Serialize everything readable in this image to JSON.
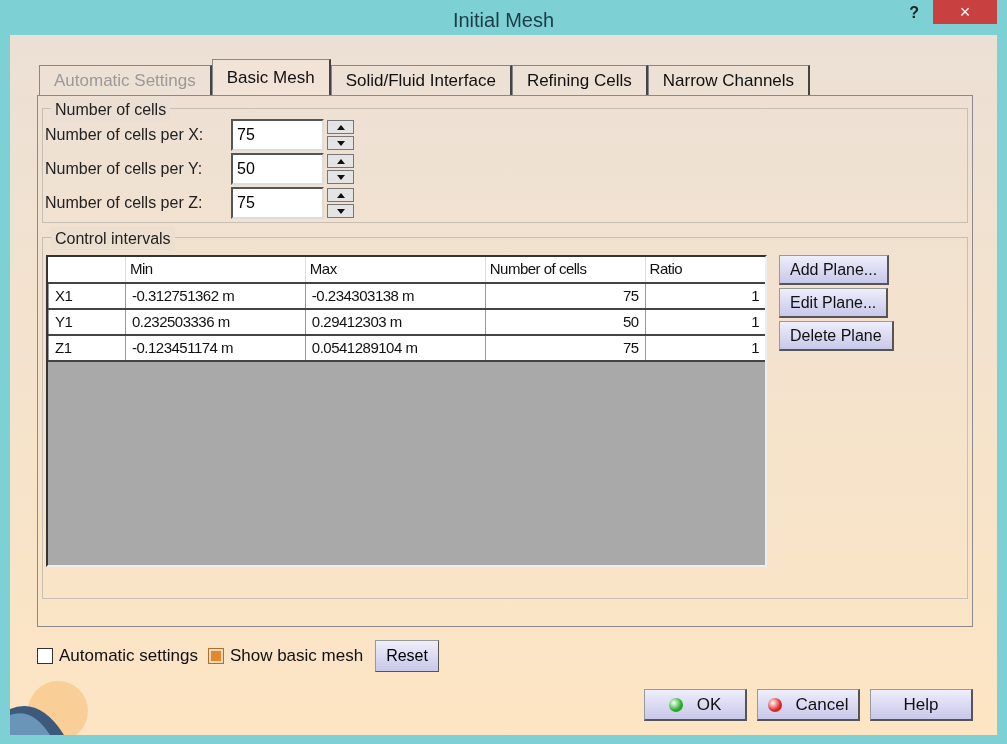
{
  "window": {
    "title": "Initial Mesh",
    "help": "?",
    "close": "×"
  },
  "tabs": [
    {
      "label": "Automatic Settings",
      "selected": false,
      "disabled": true
    },
    {
      "label": "Basic Mesh",
      "selected": true,
      "disabled": false
    },
    {
      "label": "Solid/Fluid Interface",
      "selected": false,
      "disabled": false
    },
    {
      "label": "Refining Cells",
      "selected": false,
      "disabled": false
    },
    {
      "label": "Narrow Channels",
      "selected": false,
      "disabled": false
    }
  ],
  "number_of_cells": {
    "title": "Number of cells",
    "fields": [
      {
        "label": "Number of cells per X:",
        "value": "75"
      },
      {
        "label": "Number of cells per Y:",
        "value": "50"
      },
      {
        "label": "Number of cells per Z:",
        "value": "75"
      }
    ]
  },
  "control_intervals": {
    "title": "Control intervals",
    "table": {
      "columns": [
        "",
        "Min",
        "Max",
        "Number of cells",
        "Ratio"
      ],
      "rows": [
        [
          "X1",
          "-0.312751362 m",
          "-0.234303138 m",
          "75",
          "1"
        ],
        [
          "Y1",
          "0.232503336 m",
          "0.29412303 m",
          "50",
          "1"
        ],
        [
          "Z1",
          "-0.123451174 m",
          "0.0541289104 m",
          "75",
          "1"
        ]
      ]
    },
    "buttons": [
      "Add Plane...",
      "Edit Plane...",
      "Delete Plane"
    ]
  },
  "options": [
    {
      "label": "Automatic settings",
      "checked": false
    },
    {
      "label": "Show basic mesh",
      "checked": true
    }
  ],
  "reset_button": "Reset",
  "dialog_buttons": [
    {
      "label": "OK",
      "kind": "ok"
    },
    {
      "label": "Cancel",
      "kind": "cancel"
    },
    {
      "label": "Help",
      "kind": "plain"
    }
  ]
}
